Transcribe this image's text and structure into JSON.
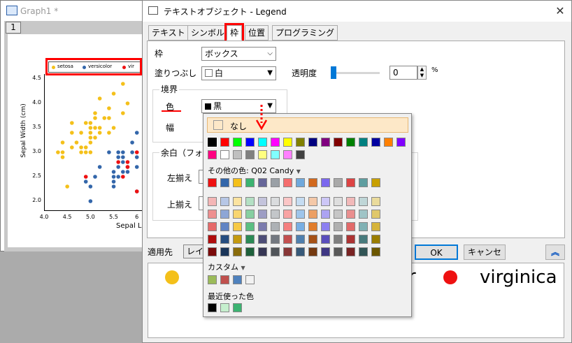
{
  "graph_window": {
    "title": "Graph1 *",
    "layer_tab": "1",
    "y_axis_label": "Sepal Width (cm)",
    "x_axis_label": "Sepal L",
    "y_ticks": [
      "4.5",
      "4.0",
      "3.5",
      "3.0",
      "2.5",
      "2.0"
    ],
    "x_ticks": [
      "4.0",
      "4.5",
      "5.0",
      "5.5",
      "6"
    ],
    "legend_items": [
      "setosa",
      "versicolor",
      "vir"
    ]
  },
  "dialog": {
    "title": "テキストオブジェクト - Legend",
    "close_glyph": "✕",
    "tabs": [
      "テキスト",
      "シンボル",
      "枠",
      "位置",
      "プログラミング"
    ],
    "active_tab": "枠",
    "frame_label": "枠",
    "frame_value": "ボックス",
    "fill_label": "塗りつぶし",
    "fill_value": "白",
    "transparency_label": "透明度",
    "transparency_value": "0",
    "transparency_unit": "%",
    "border_group_label": "境界",
    "color_label": "色",
    "color_value": "黒",
    "width_label": "幅",
    "margin_group_label": "余白（フォン",
    "left_align_label": "左揃え",
    "top_align_label": "上揃え",
    "apply_to_label": "適用先",
    "apply_to_value": "レイ",
    "ok_label": "OK",
    "cancel_label": "キャンセル",
    "expand_glyph": "︽",
    "preview_text_partial": "r",
    "preview_virginica": "virginica"
  },
  "color_popup": {
    "none_label": "なし",
    "other_colors_label": "その他の色: Q02 Candy",
    "custom_label": "カスタム",
    "recent_label": "最近使った色",
    "basic_row1": [
      "#000000",
      "#ff0000",
      "#00ff00",
      "#0000ff",
      "#00ffff",
      "#ff00ff",
      "#ffff00",
      "#808000",
      "#000080",
      "#800080",
      "#800000",
      "#008000",
      "#008080",
      "#0000a0",
      "#ff8000",
      "#8000ff"
    ],
    "basic_row2": [
      "#ff0080",
      "#ffffff",
      "#c0c0c0",
      "#808080",
      "#ffff80",
      "#80ffff",
      "#ff80ff",
      "#404040"
    ],
    "candy_row": [
      "#ee1111",
      "#3366aa",
      "#f4c01a",
      "#3cb371",
      "#666699",
      "#9aa0a6",
      "#f46d6d",
      "#6fa8dc",
      "#d2691e",
      "#7b68ee",
      "#a9a9a9",
      "#dd4444",
      "#5f9ea0",
      "#c8a000"
    ],
    "grid_rows": [
      [
        "#f4b6b6",
        "#b7c7e6",
        "#fbe3a0",
        "#b4e0c4",
        "#c4c4dc",
        "#dadcde",
        "#fbc6c6",
        "#c5dcf2",
        "#f4c8a8",
        "#cdc7f7",
        "#dedede",
        "#f2b9b9",
        "#bfd6d7",
        "#eadb9c"
      ],
      [
        "#ee8f8f",
        "#8ea6d6",
        "#f8d570",
        "#87cfa1",
        "#9d9dc4",
        "#c3c6c9",
        "#f8a3a3",
        "#9ec5eb",
        "#ec9f64",
        "#aca3f2",
        "#c6c6c6",
        "#ea8f8f",
        "#9fc4c6",
        "#e0c86a"
      ],
      [
        "#e66a6a",
        "#6184c4",
        "#f6c946",
        "#5bbf82",
        "#7b7bae",
        "#adb1b5",
        "#f58080",
        "#78aee3",
        "#e17c2a",
        "#8b7ff0",
        "#b0b0b0",
        "#e26a6a",
        "#7fb1b4",
        "#d6b43a"
      ],
      [
        "#b00d0d",
        "#264d80",
        "#c49a10",
        "#2b8a55",
        "#4d4d77",
        "#737880",
        "#c34f4f",
        "#4f7fae",
        "#a65217",
        "#5a4ebc",
        "#7f7f7f",
        "#ad3333",
        "#477a7c",
        "#9a7d00"
      ],
      [
        "#7a0909",
        "#1a3559",
        "#8a6c0b",
        "#1e603b",
        "#363654",
        "#505459",
        "#883737",
        "#375979",
        "#743910",
        "#3f3784",
        "#595959",
        "#792323",
        "#325556",
        "#6c5700"
      ]
    ],
    "custom_colors": [
      "#9bbb59",
      "#c0504d",
      "#4f81bd",
      "#f2f2f2"
    ],
    "recent_colors": [
      "#000000",
      "#c6efce",
      "#3cb371"
    ]
  },
  "chart_data": {
    "type": "scatter",
    "title": "",
    "xlabel": "Sepal L",
    "ylabel": "Sepal Width (cm)",
    "xlim": [
      4.0,
      6.2
    ],
    "ylim": [
      1.8,
      4.6
    ],
    "series": [
      {
        "name": "setosa",
        "color": "#f4c01a",
        "points": [
          [
            4.3,
            3.0
          ],
          [
            4.4,
            2.9
          ],
          [
            4.4,
            3.0
          ],
          [
            4.4,
            3.2
          ],
          [
            4.5,
            2.3
          ],
          [
            4.6,
            3.1
          ],
          [
            4.6,
            3.4
          ],
          [
            4.6,
            3.6
          ],
          [
            4.7,
            3.2
          ],
          [
            4.8,
            3.0
          ],
          [
            4.8,
            3.1
          ],
          [
            4.8,
            3.4
          ],
          [
            4.9,
            3.0
          ],
          [
            4.9,
            3.1
          ],
          [
            4.9,
            3.6
          ],
          [
            5.0,
            3.0
          ],
          [
            5.0,
            3.2
          ],
          [
            5.0,
            3.3
          ],
          [
            5.0,
            3.4
          ],
          [
            5.0,
            3.5
          ],
          [
            5.0,
            3.6
          ],
          [
            5.1,
            3.3
          ],
          [
            5.1,
            3.5
          ],
          [
            5.1,
            3.7
          ],
          [
            5.1,
            3.8
          ],
          [
            5.2,
            3.4
          ],
          [
            5.2,
            3.5
          ],
          [
            5.2,
            4.1
          ],
          [
            5.3,
            3.7
          ],
          [
            5.4,
            3.4
          ],
          [
            5.4,
            3.7
          ],
          [
            5.4,
            3.9
          ],
          [
            5.5,
            3.5
          ],
          [
            5.5,
            4.2
          ],
          [
            5.7,
            3.8
          ],
          [
            5.7,
            4.4
          ],
          [
            5.8,
            4.0
          ]
        ]
      },
      {
        "name": "versicolor",
        "color": "#3366aa",
        "points": [
          [
            4.9,
            2.4
          ],
          [
            5.0,
            2.0
          ],
          [
            5.0,
            2.3
          ],
          [
            5.1,
            2.5
          ],
          [
            5.2,
            2.7
          ],
          [
            5.4,
            3.0
          ],
          [
            5.5,
            2.3
          ],
          [
            5.5,
            2.4
          ],
          [
            5.5,
            2.5
          ],
          [
            5.5,
            2.6
          ],
          [
            5.6,
            2.5
          ],
          [
            5.6,
            2.7
          ],
          [
            5.6,
            2.9
          ],
          [
            5.6,
            3.0
          ],
          [
            5.7,
            2.6
          ],
          [
            5.7,
            2.8
          ],
          [
            5.7,
            2.9
          ],
          [
            5.7,
            3.0
          ],
          [
            5.8,
            2.6
          ],
          [
            5.8,
            2.7
          ],
          [
            5.9,
            3.0
          ],
          [
            5.9,
            3.2
          ],
          [
            6.0,
            2.2
          ],
          [
            6.0,
            2.7
          ],
          [
            6.0,
            2.9
          ],
          [
            6.0,
            3.4
          ]
        ]
      },
      {
        "name": "virginica",
        "color": "#ee1111",
        "points": [
          [
            4.9,
            2.5
          ],
          [
            5.6,
            2.8
          ],
          [
            5.7,
            2.5
          ],
          [
            5.8,
            2.7
          ],
          [
            5.8,
            2.8
          ],
          [
            6.0,
            2.2
          ],
          [
            6.0,
            3.0
          ]
        ]
      }
    ]
  }
}
